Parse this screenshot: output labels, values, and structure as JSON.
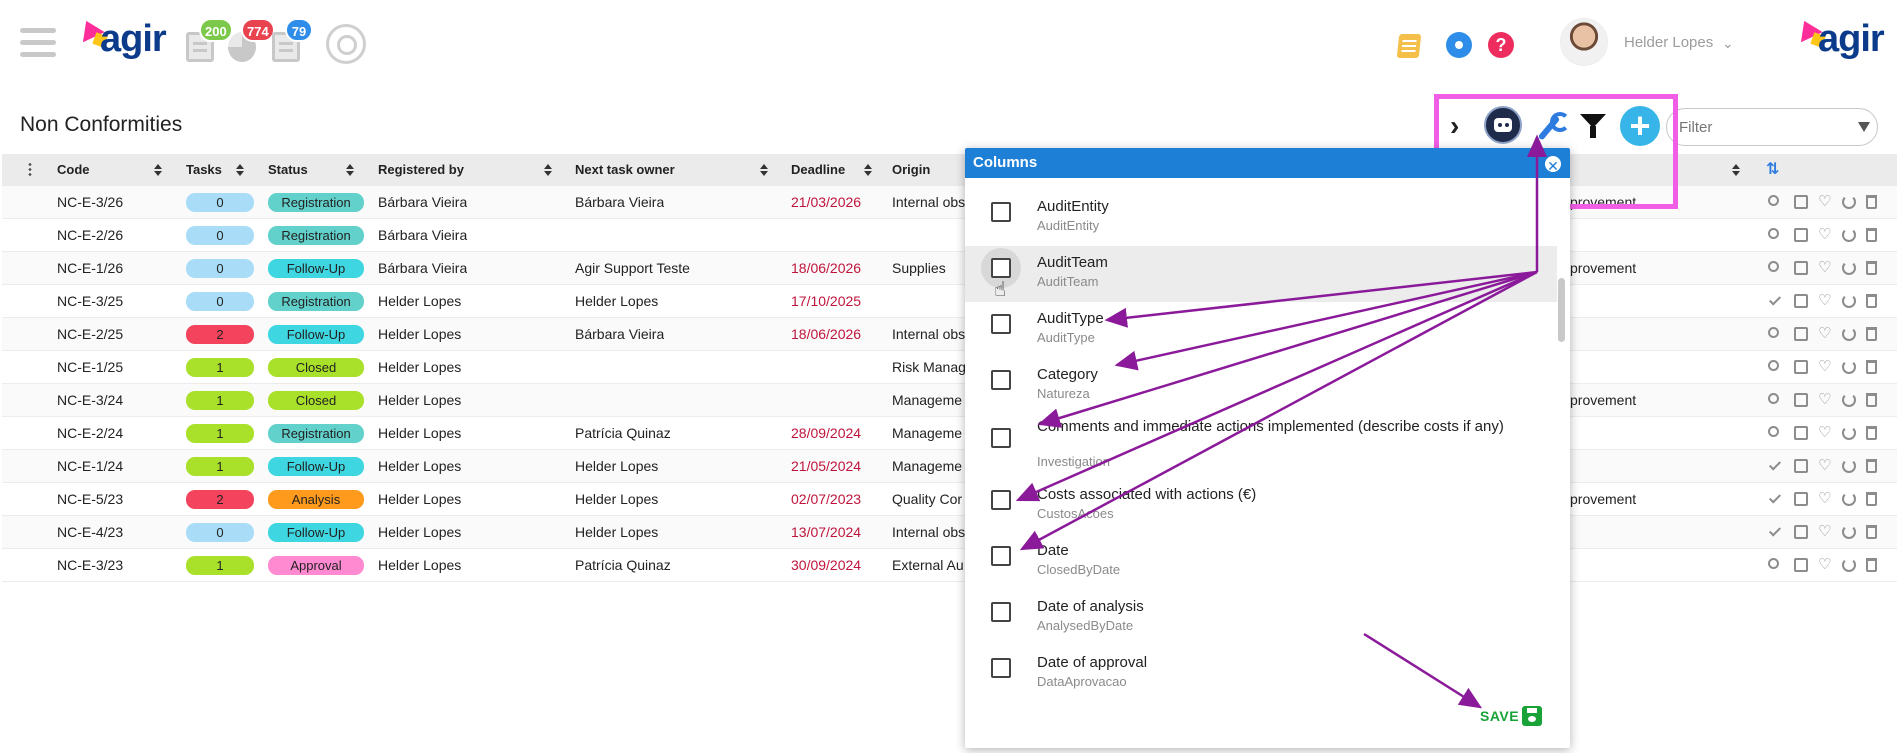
{
  "header": {
    "brand": "agir",
    "badges": [
      {
        "value": "200",
        "color": "#7cc84a"
      },
      {
        "value": "774",
        "color": "#e8434f"
      },
      {
        "value": "79",
        "color": "#2e8de8"
      }
    ],
    "help": "?",
    "user_name": "Helder Lopes"
  },
  "page": {
    "title": "Non Conformities",
    "filter_placeholder": "Filter",
    "add_label": "+"
  },
  "table": {
    "columns": [
      "Code",
      "Tasks",
      "Status",
      "Registered by",
      "Next task owner",
      "Deadline",
      "Origin"
    ],
    "rows": [
      {
        "code": "NC-E-3/26",
        "tasks": "0",
        "status": "Registration",
        "registered": "Bárbara Vieira",
        "owner": "Bárbara Vieira",
        "deadline": "21/03/2026",
        "origin": "Internal obs",
        "extra": "provement"
      },
      {
        "code": "NC-E-2/26",
        "tasks": "0",
        "status": "Registration",
        "registered": "Bárbara Vieira",
        "owner": "",
        "deadline": "",
        "origin": "",
        "extra": ""
      },
      {
        "code": "NC-E-1/26",
        "tasks": "0",
        "status": "Follow-Up",
        "registered": "Bárbara Vieira",
        "owner": "Agir Support Teste",
        "deadline": "18/06/2026",
        "origin": "Supplies",
        "extra": "provement"
      },
      {
        "code": "NC-E-3/25",
        "tasks": "0",
        "status": "Registration",
        "registered": "Helder Lopes",
        "owner": "Helder Lopes",
        "deadline": "17/10/2025",
        "origin": "",
        "extra": ""
      },
      {
        "code": "NC-E-2/25",
        "tasks": "2",
        "status": "Follow-Up",
        "registered": "Helder Lopes",
        "owner": "Bárbara Vieira",
        "deadline": "18/06/2026",
        "origin": "Internal obs",
        "extra": ""
      },
      {
        "code": "NC-E-1/25",
        "tasks": "1",
        "status": "Closed",
        "registered": "Helder Lopes",
        "owner": "",
        "deadline": "",
        "origin": "Risk Manag",
        "extra": ""
      },
      {
        "code": "NC-E-3/24",
        "tasks": "1",
        "status": "Closed",
        "registered": "Helder Lopes",
        "owner": "",
        "deadline": "",
        "origin": "Manageme",
        "extra": "provement"
      },
      {
        "code": "NC-E-2/24",
        "tasks": "1",
        "status": "Registration",
        "registered": "Helder Lopes",
        "owner": "Patrícia Quinaz",
        "deadline": "28/09/2024",
        "origin": "Manageme",
        "extra": ""
      },
      {
        "code": "NC-E-1/24",
        "tasks": "1",
        "status": "Follow-Up",
        "registered": "Helder Lopes",
        "owner": "Helder Lopes",
        "deadline": "21/05/2024",
        "origin": "Manageme",
        "extra": ""
      },
      {
        "code": "NC-E-5/23",
        "tasks": "2",
        "status": "Analysis",
        "registered": "Helder Lopes",
        "owner": "Helder Lopes",
        "deadline": "02/07/2023",
        "origin": "Quality Cor",
        "extra": "provement"
      },
      {
        "code": "NC-E-4/23",
        "tasks": "0",
        "status": "Follow-Up",
        "registered": "Helder Lopes",
        "owner": "Helder Lopes",
        "deadline": "13/07/2024",
        "origin": "Internal obs",
        "extra": ""
      },
      {
        "code": "NC-E-3/23",
        "tasks": "1",
        "status": "Approval",
        "registered": "Helder Lopes",
        "owner": "Patrícia Quinaz",
        "deadline": "30/09/2024",
        "origin": "External Au",
        "extra": ""
      }
    ]
  },
  "colors": {
    "task_0": "#a9ddf7",
    "task_1": "#a8e02a",
    "task_2": "#f4445d",
    "status_registration": "#62d1cc",
    "status_followup": "#3ed6e0",
    "status_closed": "#a8e02a",
    "status_analysis": "#ff9a1c",
    "status_approval": "#ff8ad2",
    "arrow": "#8b1a9a",
    "highlight": "#f25de6"
  },
  "columns_panel": {
    "title": "Columns",
    "items": [
      {
        "label": "AuditEntity",
        "field": "AuditEntity"
      },
      {
        "label": "AuditTeam",
        "field": "AuditTeam"
      },
      {
        "label": "AuditType",
        "field": "AuditType"
      },
      {
        "label": "Category",
        "field": "Natureza"
      },
      {
        "label": "Comments and immediate actions implemented (describe costs if any)",
        "field": "Investigation"
      },
      {
        "label": "Costs associated with actions (€)",
        "field": "CustosAcoes"
      },
      {
        "label": "Date",
        "field": "ClosedByDate"
      },
      {
        "label": "Date of analysis",
        "field": "AnalysedByDate"
      },
      {
        "label": "Date of approval",
        "field": "DataAprovacao"
      }
    ],
    "save_label": "SAVE"
  }
}
